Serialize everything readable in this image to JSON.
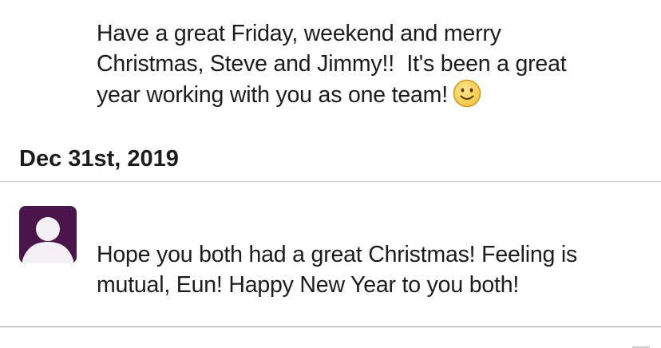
{
  "messages": [
    {
      "lines": [
        "Have a great Friday, weekend and merry",
        "Christmas, Steve and Jimmy!!  It's been a great",
        "year working with you as one team!"
      ],
      "emoji": "slightly-smiling-face"
    },
    {
      "lines": [
        "Hope you both had a great Christmas! Feeling is",
        "mutual, Eun! Happy New Year to you both!"
      ]
    }
  ],
  "date_divider": "Dec 31st, 2019",
  "colors": {
    "avatar_bg": "#4a154b",
    "avatar_fg": "#f4f0f5",
    "emoji_face": "#f5c542",
    "emoji_outline": "#d29a1e",
    "text": "#1d1c1d"
  }
}
